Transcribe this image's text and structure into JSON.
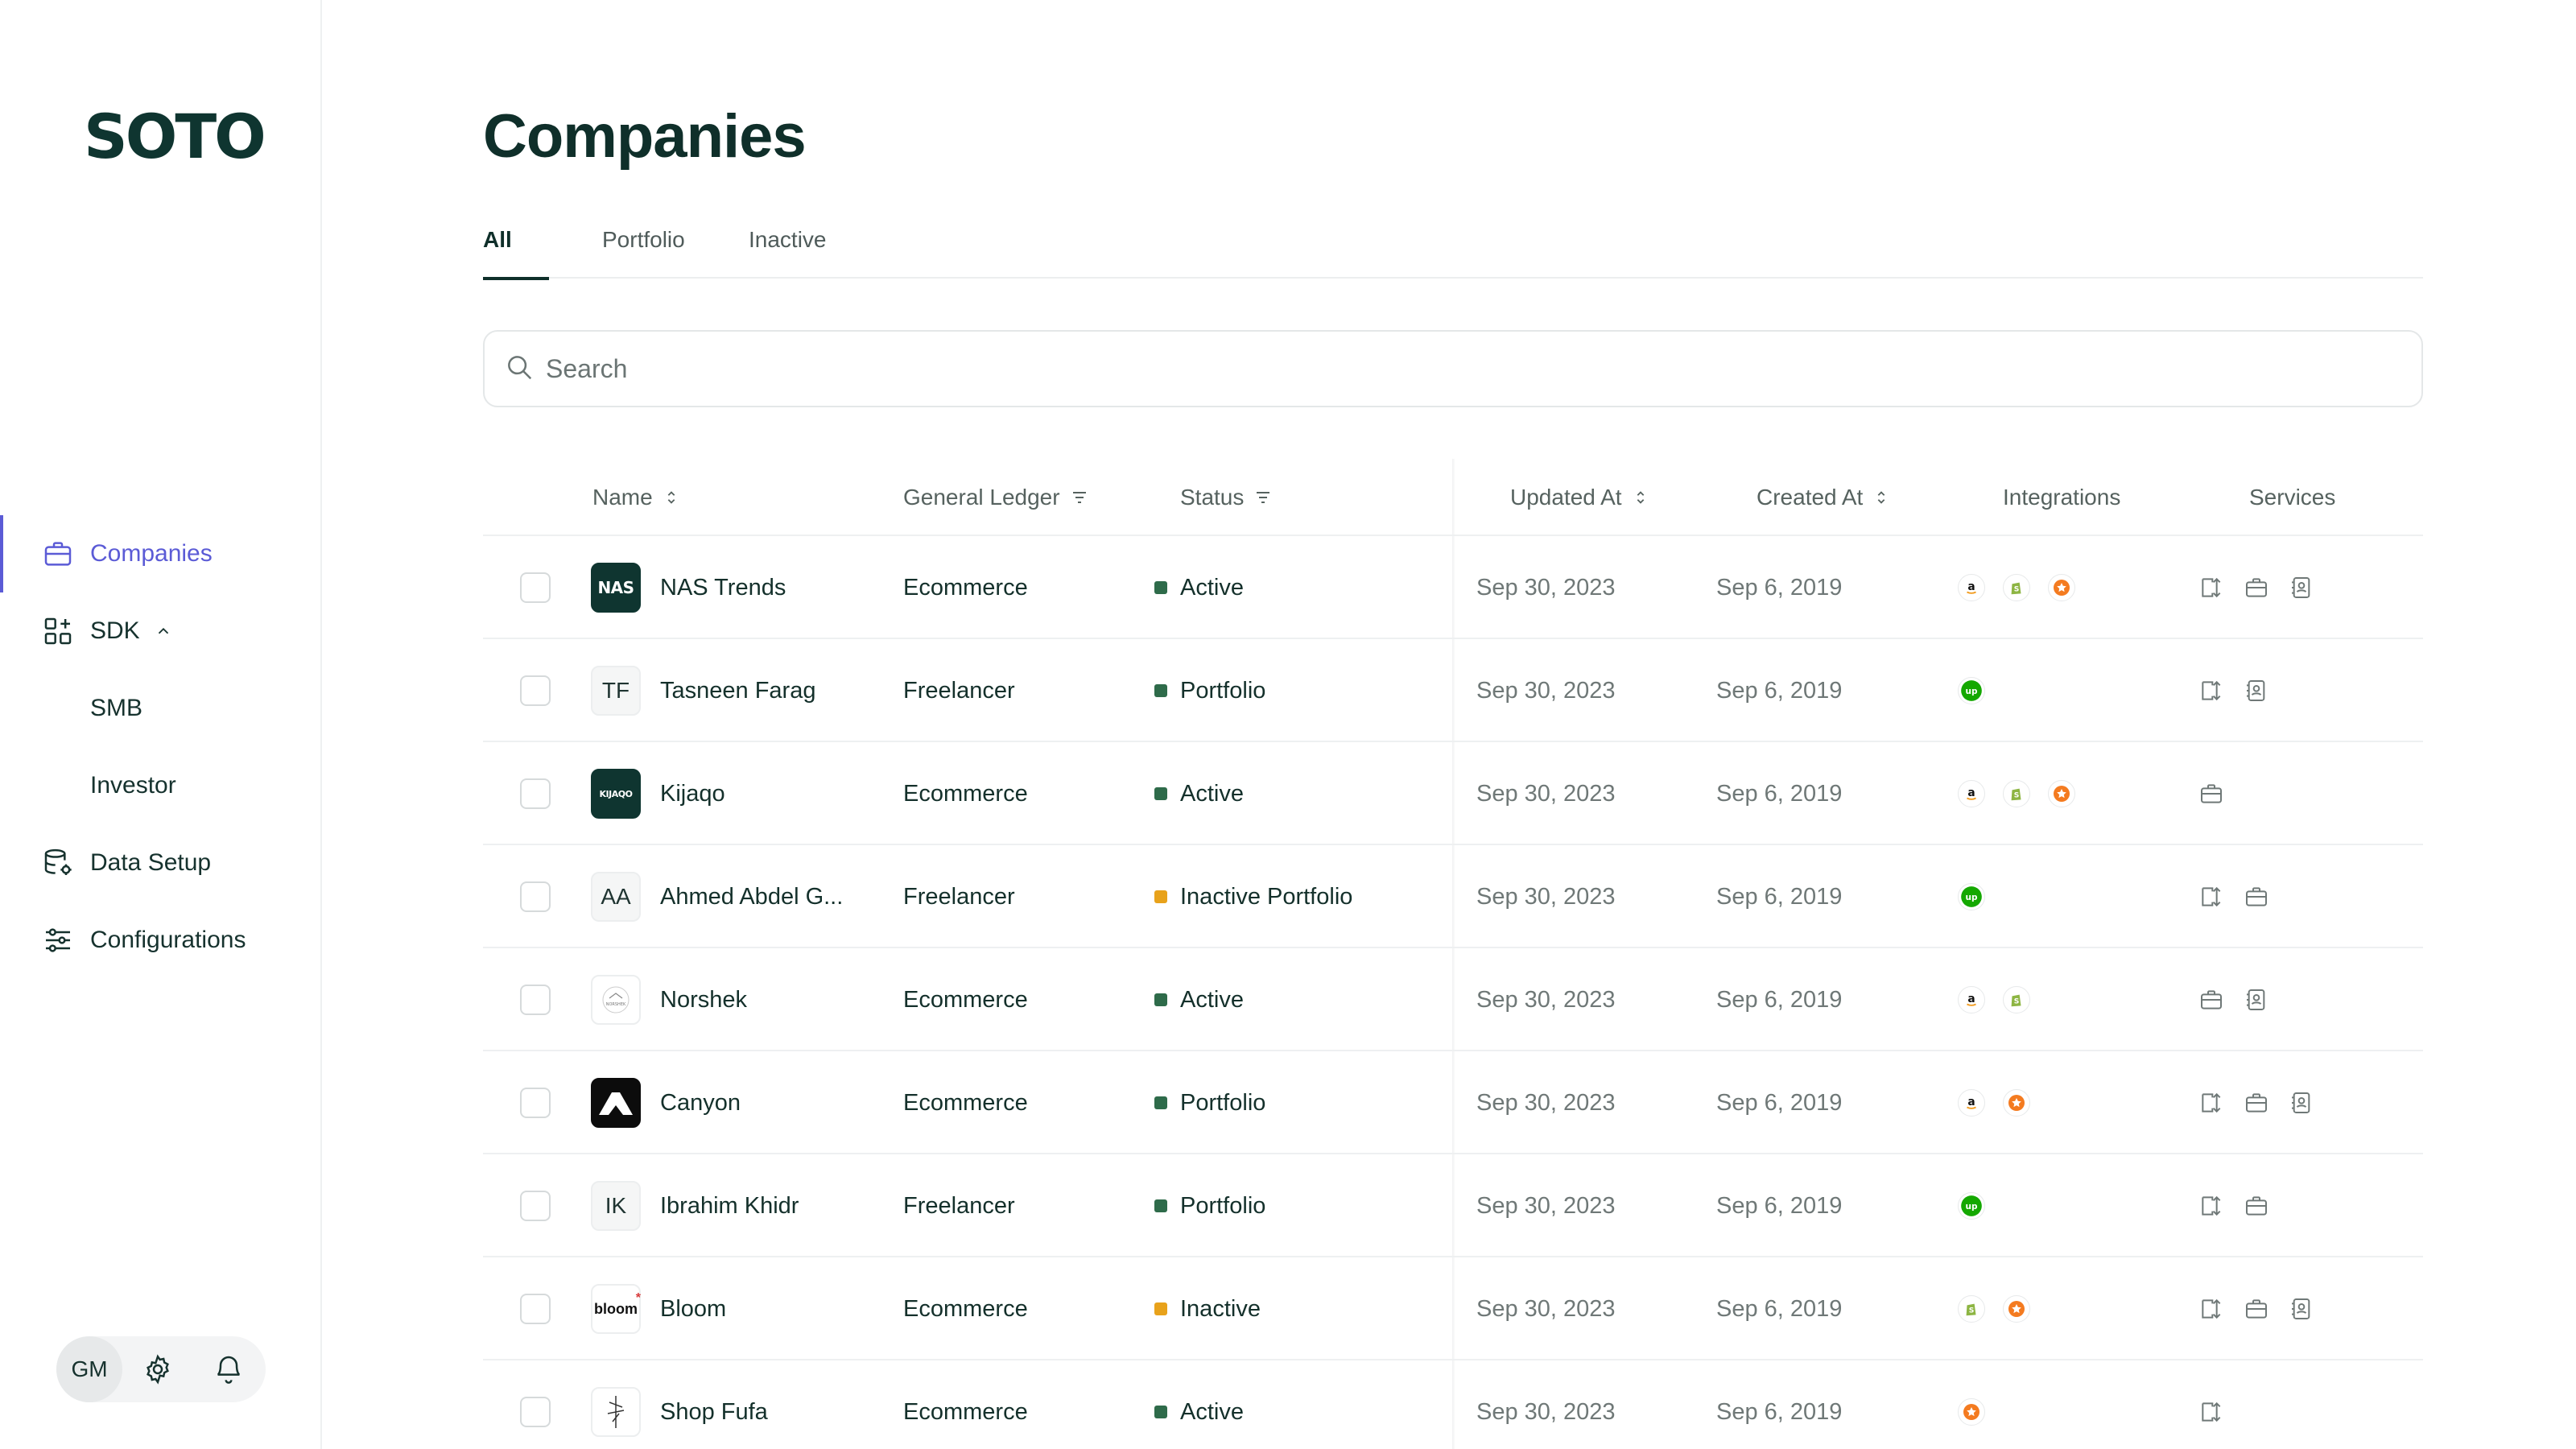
{
  "brand": {
    "logo_text": "SOTO"
  },
  "sidebar": {
    "items": [
      {
        "label": "Companies",
        "icon": "briefcase-icon",
        "active": true
      },
      {
        "label": "SDK",
        "icon": "grid-plus-icon",
        "expanded": true
      },
      {
        "label": "SMB"
      },
      {
        "label": "Investor"
      },
      {
        "label": "Data Setup",
        "icon": "database-gear-icon"
      },
      {
        "label": "Configurations",
        "icon": "sliders-icon"
      }
    ],
    "footer": {
      "avatar_initials": "GM",
      "settings_icon": "gear-icon",
      "notifications_icon": "bell-icon"
    }
  },
  "page": {
    "title": "Companies"
  },
  "tabs": [
    {
      "label": "All",
      "active": true
    },
    {
      "label": "Portfolio"
    },
    {
      "label": "Inactive"
    }
  ],
  "search": {
    "placeholder": "Search",
    "value": ""
  },
  "table": {
    "columns": {
      "name": "Name",
      "ledger": "General Ledger",
      "status": "Status",
      "updated": "Updated At",
      "created": "Created At",
      "integrations": "Integrations",
      "services": "Services"
    },
    "rows": [
      {
        "name": "NAS Trends",
        "logo": "NAS",
        "logo_style": "dark",
        "ledger": "Ecommerce",
        "status": "Active",
        "status_color": "#2e6b4a",
        "updated": "Sep 30, 2023",
        "created": "Sep 6, 2019",
        "integrations": [
          "amazon",
          "shopify",
          "star"
        ],
        "services": [
          "transfer",
          "briefcase",
          "contact"
        ]
      },
      {
        "name": "Tasneen Farag",
        "logo": "TF",
        "logo_style": "initials",
        "ledger": "Freelancer",
        "status": "Portfolio",
        "status_color": "#2e6b4a",
        "updated": "Sep 30, 2023",
        "created": "Sep 6, 2019",
        "integrations": [
          "upwork"
        ],
        "services": [
          "transfer",
          "contact"
        ]
      },
      {
        "name": "Kijaqo",
        "logo": "KIJAQO",
        "logo_style": "dark",
        "ledger": "Ecommerce",
        "status": "Active",
        "status_color": "#2e6b4a",
        "updated": "Sep 30, 2023",
        "created": "Sep 6, 2019",
        "integrations": [
          "amazon",
          "shopify",
          "star"
        ],
        "services": [
          "briefcase"
        ]
      },
      {
        "name": "Ahmed Abdel G...",
        "logo": "AA",
        "logo_style": "initials",
        "ledger": "Freelancer",
        "status": "Inactive Portfolio",
        "status_color": "#e8a21b",
        "updated": "Sep 30, 2023",
        "created": "Sep 6, 2019",
        "integrations": [
          "upwork"
        ],
        "services": [
          "transfer",
          "briefcase"
        ]
      },
      {
        "name": "Norshek",
        "logo": "NORSHEK",
        "logo_style": "white",
        "ledger": "Ecommerce",
        "status": "Active",
        "status_color": "#2e6b4a",
        "updated": "Sep 30, 2023",
        "created": "Sep 6, 2019",
        "integrations": [
          "amazon",
          "shopify"
        ],
        "services": [
          "briefcase",
          "contact"
        ]
      },
      {
        "name": "Canyon",
        "logo": "",
        "logo_style": "black",
        "ledger": "Ecommerce",
        "status": "Portfolio",
        "status_color": "#2e6b4a",
        "updated": "Sep 30, 2023",
        "created": "Sep 6, 2019",
        "integrations": [
          "amazon",
          "star"
        ],
        "services": [
          "transfer",
          "briefcase",
          "contact"
        ]
      },
      {
        "name": "Ibrahim Khidr",
        "logo": "IK",
        "logo_style": "initials",
        "ledger": "Freelancer",
        "status": "Portfolio",
        "status_color": "#2e6b4a",
        "updated": "Sep 30, 2023",
        "created": "Sep 6, 2019",
        "integrations": [
          "upwork"
        ],
        "services": [
          "transfer",
          "briefcase"
        ]
      },
      {
        "name": "Bloom",
        "logo": "bloom",
        "logo_style": "white",
        "ledger": "Ecommerce",
        "status": "Inactive",
        "status_color": "#e8a21b",
        "updated": "Sep 30, 2023",
        "created": "Sep 6, 2019",
        "integrations": [
          "shopify",
          "star"
        ],
        "services": [
          "transfer",
          "briefcase",
          "contact"
        ]
      },
      {
        "name": "Shop Fufa",
        "logo": "",
        "logo_style": "white",
        "ledger": "Ecommerce",
        "status": "Active",
        "status_color": "#2e6b4a",
        "updated": "Sep 30, 2023",
        "created": "Sep 6, 2019",
        "integrations": [
          "star"
        ],
        "services": [
          "transfer"
        ]
      }
    ]
  }
}
